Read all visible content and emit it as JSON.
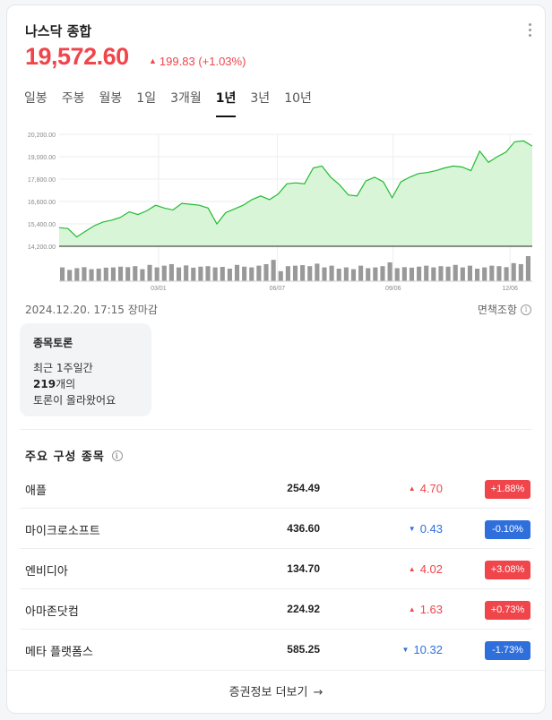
{
  "header": {
    "title": "나스닥 종합",
    "price": "19,572.60",
    "change": "199.83",
    "change_pct": "(+1.03%)",
    "change_direction": "up"
  },
  "tabs": [
    {
      "label": "일봉",
      "active": false
    },
    {
      "label": "주봉",
      "active": false
    },
    {
      "label": "월봉",
      "active": false
    },
    {
      "label": "1일",
      "active": false
    },
    {
      "label": "3개월",
      "active": false
    },
    {
      "label": "1년",
      "active": true
    },
    {
      "label": "3년",
      "active": false
    },
    {
      "label": "10년",
      "active": false
    }
  ],
  "chart_data": {
    "type": "area",
    "y_ticks": [
      "20,200.00",
      "19,000.00",
      "17,800.00",
      "16,600.00",
      "15,400.00",
      "14,200.00"
    ],
    "ylim": [
      14200,
      20200
    ],
    "x_ticks": [
      "03/01",
      "06/07",
      "09/06",
      "12/06"
    ],
    "values": [
      15200,
      15150,
      14700,
      15000,
      15300,
      15500,
      15600,
      15750,
      16050,
      15900,
      16100,
      16400,
      16250,
      16150,
      16500,
      16450,
      16400,
      16250,
      15400,
      16000,
      16200,
      16400,
      16700,
      16900,
      16700,
      17000,
      17550,
      17600,
      17550,
      18400,
      18500,
      17900,
      17500,
      16950,
      16900,
      17700,
      17900,
      17650,
      16800,
      17650,
      17900,
      18100,
      18150,
      18250,
      18400,
      18500,
      18450,
      18250,
      19300,
      18700,
      19000,
      19250,
      19800,
      19850,
      19570
    ],
    "volumes": [
      0.55,
      0.45,
      0.52,
      0.56,
      0.48,
      0.5,
      0.54,
      0.55,
      0.58,
      0.56,
      0.6,
      0.48,
      0.65,
      0.55,
      0.62,
      0.68,
      0.55,
      0.63,
      0.54,
      0.58,
      0.6,
      0.55,
      0.57,
      0.5,
      0.65,
      0.58,
      0.55,
      0.62,
      0.68,
      0.85,
      0.4,
      0.6,
      0.62,
      0.64,
      0.6,
      0.7,
      0.55,
      0.62,
      0.5,
      0.55,
      0.48,
      0.62,
      0.52,
      0.55,
      0.6,
      0.75,
      0.52,
      0.56,
      0.54,
      0.58,
      0.62,
      0.55,
      0.6,
      0.58,
      0.65,
      0.55,
      0.62,
      0.5,
      0.55,
      0.62,
      0.6,
      0.56,
      0.72,
      0.68,
      1.0
    ],
    "line_color": "#22bb33",
    "fill_color": "#d8f5d8"
  },
  "meta": {
    "timestamp": "2024.12.20. 17:15 장마감",
    "disclaimer": "면책조항"
  },
  "discussion": {
    "title": "종목토론",
    "line1": "최근 1주일간",
    "count": "219",
    "line2_suffix": "개의",
    "line3": "토론이 올라왔어요"
  },
  "components": {
    "title": "주요 구성 종목",
    "rows": [
      {
        "name": "애플",
        "price": "254.49",
        "diff": "4.70",
        "pct": "+1.88%",
        "dir": "up"
      },
      {
        "name": "마이크로소프트",
        "price": "436.60",
        "diff": "0.43",
        "pct": "-0.10%",
        "dir": "down"
      },
      {
        "name": "엔비디아",
        "price": "134.70",
        "diff": "4.02",
        "pct": "+3.08%",
        "dir": "up"
      },
      {
        "name": "아마존닷컴",
        "price": "224.92",
        "diff": "1.63",
        "pct": "+0.73%",
        "dir": "up"
      },
      {
        "name": "메타 플랫폼스",
        "price": "585.25",
        "diff": "10.32",
        "pct": "-1.73%",
        "dir": "down"
      }
    ]
  },
  "footer": {
    "label": "증권정보 더보기",
    "arrow": "→"
  },
  "colors": {
    "up": "#f0454b",
    "down": "#2f6fdc"
  }
}
